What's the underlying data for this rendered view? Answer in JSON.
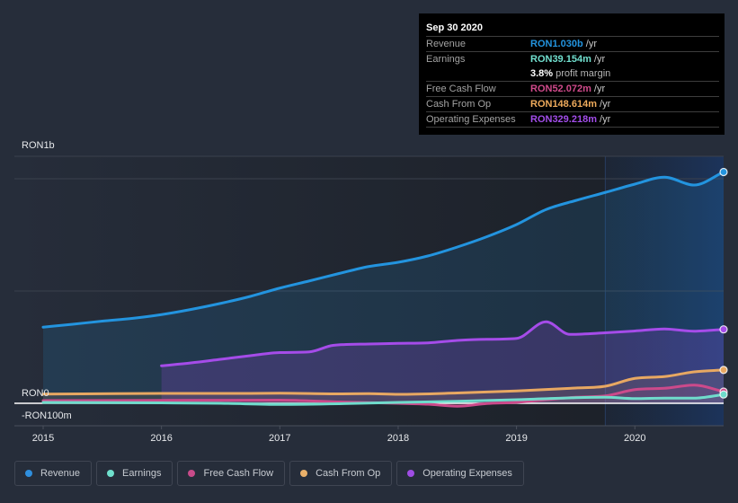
{
  "tooltip": {
    "date": "Sep 30 2020",
    "revenue": {
      "label": "Revenue",
      "value": "RON1.030b",
      "unit": " /yr",
      "color": "#2394df"
    },
    "earnings": {
      "label": "Earnings",
      "value": "RON39.154m",
      "unit": " /yr",
      "color": "#71e0cf"
    },
    "profit_margin": {
      "value": "3.8%",
      "unit": " profit margin"
    },
    "free_cash_flow": {
      "label": "Free Cash Flow",
      "value": "RON52.072m",
      "unit": " /yr",
      "color": "#d04a8b"
    },
    "cash_from_op": {
      "label": "Cash From Op",
      "value": "RON148.614m",
      "unit": " /yr",
      "color": "#efab5c"
    },
    "operating_expenses": {
      "label": "Operating Expenses",
      "value": "RON329.218m",
      "unit": " /yr",
      "color": "#a24de9"
    }
  },
  "legend": [
    {
      "label": "Revenue",
      "color": "#2f8fde"
    },
    {
      "label": "Earnings",
      "color": "#6fe0cd"
    },
    {
      "label": "Free Cash Flow",
      "color": "#c84b8a"
    },
    {
      "label": "Cash From Op",
      "color": "#e9b06a"
    },
    {
      "label": "Operating Expenses",
      "color": "#9f4de4"
    }
  ],
  "chart_data": {
    "type": "area",
    "title": "",
    "xlabel": "",
    "ylabel": "",
    "units": "RON millions",
    "ylim": [
      -100,
      1100
    ],
    "xlim": [
      2015,
      2020.75
    ],
    "grid": true,
    "legend_position": "bottom-left",
    "highlight_range": [
      2019.75,
      2020.75
    ],
    "gridlines": [
      1100,
      1000,
      500,
      -100
    ],
    "zero_line": 0,
    "x_ticks": [
      {
        "value": 2015,
        "label": "2015"
      },
      {
        "value": 2016,
        "label": "2016"
      },
      {
        "value": 2017,
        "label": "2017"
      },
      {
        "value": 2018,
        "label": "2018"
      },
      {
        "value": 2019,
        "label": "2019"
      },
      {
        "value": 2020,
        "label": "2020"
      }
    ],
    "y_ticks": [
      {
        "value": 1000,
        "label": "RON1b",
        "position": "top"
      },
      {
        "value": 0,
        "label": "RON0"
      },
      {
        "value": -100,
        "label": "-RON100m"
      }
    ],
    "series": [
      {
        "name": "Revenue",
        "key": "revenue",
        "color": "#2394df",
        "fill_opacity": 0.15,
        "points": [
          [
            2015.0,
            339
          ],
          [
            2015.25,
            352
          ],
          [
            2015.5,
            366
          ],
          [
            2015.75,
            378
          ],
          [
            2016.0,
            395
          ],
          [
            2016.25,
            418
          ],
          [
            2016.5,
            445
          ],
          [
            2016.75,
            476
          ],
          [
            2017.0,
            513
          ],
          [
            2017.25,
            545
          ],
          [
            2017.5,
            578
          ],
          [
            2017.75,
            609
          ],
          [
            2018.0,
            628
          ],
          [
            2018.25,
            656
          ],
          [
            2018.5,
            696
          ],
          [
            2018.75,
            742
          ],
          [
            2019.0,
            796
          ],
          [
            2019.25,
            863
          ],
          [
            2019.5,
            903
          ],
          [
            2019.75,
            939
          ],
          [
            2020.0,
            976
          ],
          [
            2020.25,
            1007
          ],
          [
            2020.5,
            972
          ],
          [
            2020.75,
            1030
          ]
        ]
      },
      {
        "name": "Operating Expenses",
        "key": "operating-expenses",
        "color": "#a54ce9",
        "fill_opacity": 0.2,
        "points": [
          [
            2016.0,
            167
          ],
          [
            2016.25,
            180
          ],
          [
            2016.5,
            196
          ],
          [
            2016.75,
            212
          ],
          [
            2017.0,
            226
          ],
          [
            2017.25,
            229
          ],
          [
            2017.45,
            258
          ],
          [
            2017.75,
            264
          ],
          [
            2018.0,
            267
          ],
          [
            2018.25,
            269
          ],
          [
            2018.5,
            280
          ],
          [
            2018.75,
            285
          ],
          [
            2019.0,
            289
          ],
          [
            2019.25,
            363
          ],
          [
            2019.45,
            307
          ],
          [
            2019.75,
            314
          ],
          [
            2020.0,
            322
          ],
          [
            2020.25,
            331
          ],
          [
            2020.5,
            321
          ],
          [
            2020.75,
            329.218
          ]
        ]
      },
      {
        "name": "Cash From Op",
        "key": "cash-from-op",
        "color": "#e8a862",
        "fill_opacity": 0.12,
        "points": [
          [
            2015.0,
            41
          ],
          [
            2016.0,
            44
          ],
          [
            2016.75,
            44
          ],
          [
            2017.0,
            45
          ],
          [
            2017.5,
            42
          ],
          [
            2017.75,
            43
          ],
          [
            2018.0,
            40
          ],
          [
            2018.5,
            46
          ],
          [
            2019.0,
            55
          ],
          [
            2019.5,
            68
          ],
          [
            2019.75,
            76
          ],
          [
            2020.0,
            111
          ],
          [
            2020.25,
            119
          ],
          [
            2020.5,
            140
          ],
          [
            2020.75,
            148.614
          ]
        ]
      },
      {
        "name": "Free Cash Flow",
        "key": "free-cash-flow",
        "color": "#cc4a8b",
        "fill_opacity": 0.12,
        "points": [
          [
            2015.0,
            12
          ],
          [
            2016.0,
            13
          ],
          [
            2017.0,
            14
          ],
          [
            2017.5,
            6
          ],
          [
            2018.0,
            0
          ],
          [
            2018.25,
            -4
          ],
          [
            2018.5,
            -13
          ],
          [
            2018.75,
            -1
          ],
          [
            2019.0,
            4
          ],
          [
            2019.25,
            16
          ],
          [
            2019.5,
            27
          ],
          [
            2019.75,
            33
          ],
          [
            2020.0,
            61
          ],
          [
            2020.25,
            67
          ],
          [
            2020.5,
            81
          ],
          [
            2020.75,
            52.072
          ]
        ]
      },
      {
        "name": "Earnings",
        "key": "earnings",
        "color": "#6fdccc",
        "fill_opacity": 0.08,
        "points": [
          [
            2015.0,
            4
          ],
          [
            2016.0,
            2
          ],
          [
            2016.5,
            0
          ],
          [
            2017.0,
            -5
          ],
          [
            2017.5,
            -2
          ],
          [
            2018.0,
            4
          ],
          [
            2018.5,
            9
          ],
          [
            2019.0,
            16
          ],
          [
            2019.5,
            25
          ],
          [
            2019.75,
            27
          ],
          [
            2020.0,
            21
          ],
          [
            2020.25,
            23
          ],
          [
            2020.5,
            23
          ],
          [
            2020.75,
            39.154
          ]
        ]
      }
    ]
  }
}
